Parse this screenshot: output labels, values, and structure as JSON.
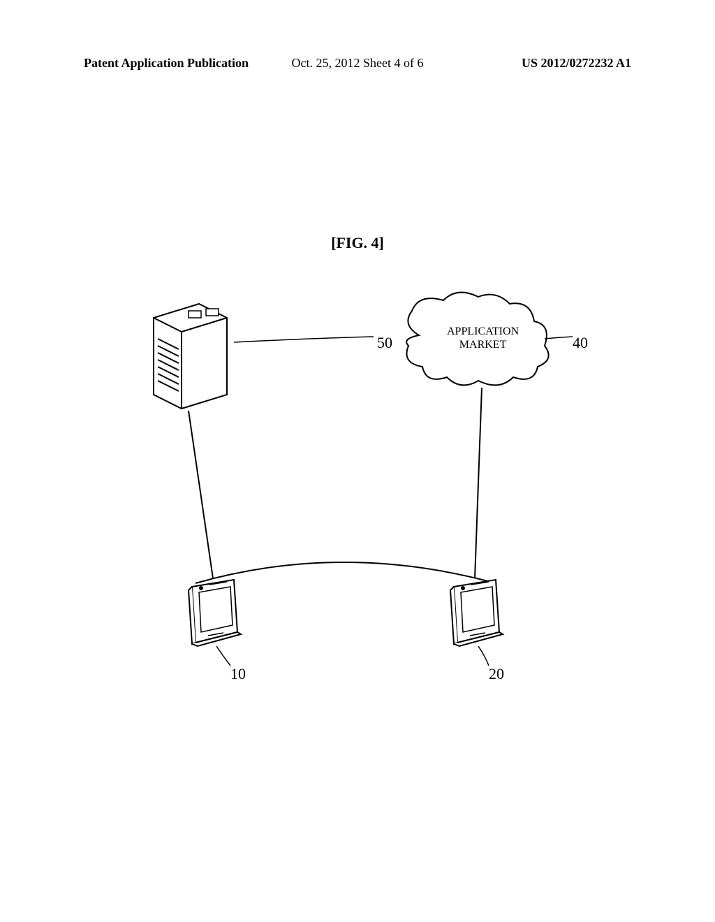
{
  "header": {
    "left": "Patent Application Publication",
    "center": "Oct. 25, 2012  Sheet 4 of 6",
    "right": "US 2012/0272232 A1"
  },
  "figure": {
    "title": "[FIG. 4]"
  },
  "labels": {
    "cloud_line1": "APPLICATION",
    "cloud_line2": "MARKET",
    "ref_50": "50",
    "ref_40": "40",
    "ref_10": "10",
    "ref_20": "20"
  }
}
